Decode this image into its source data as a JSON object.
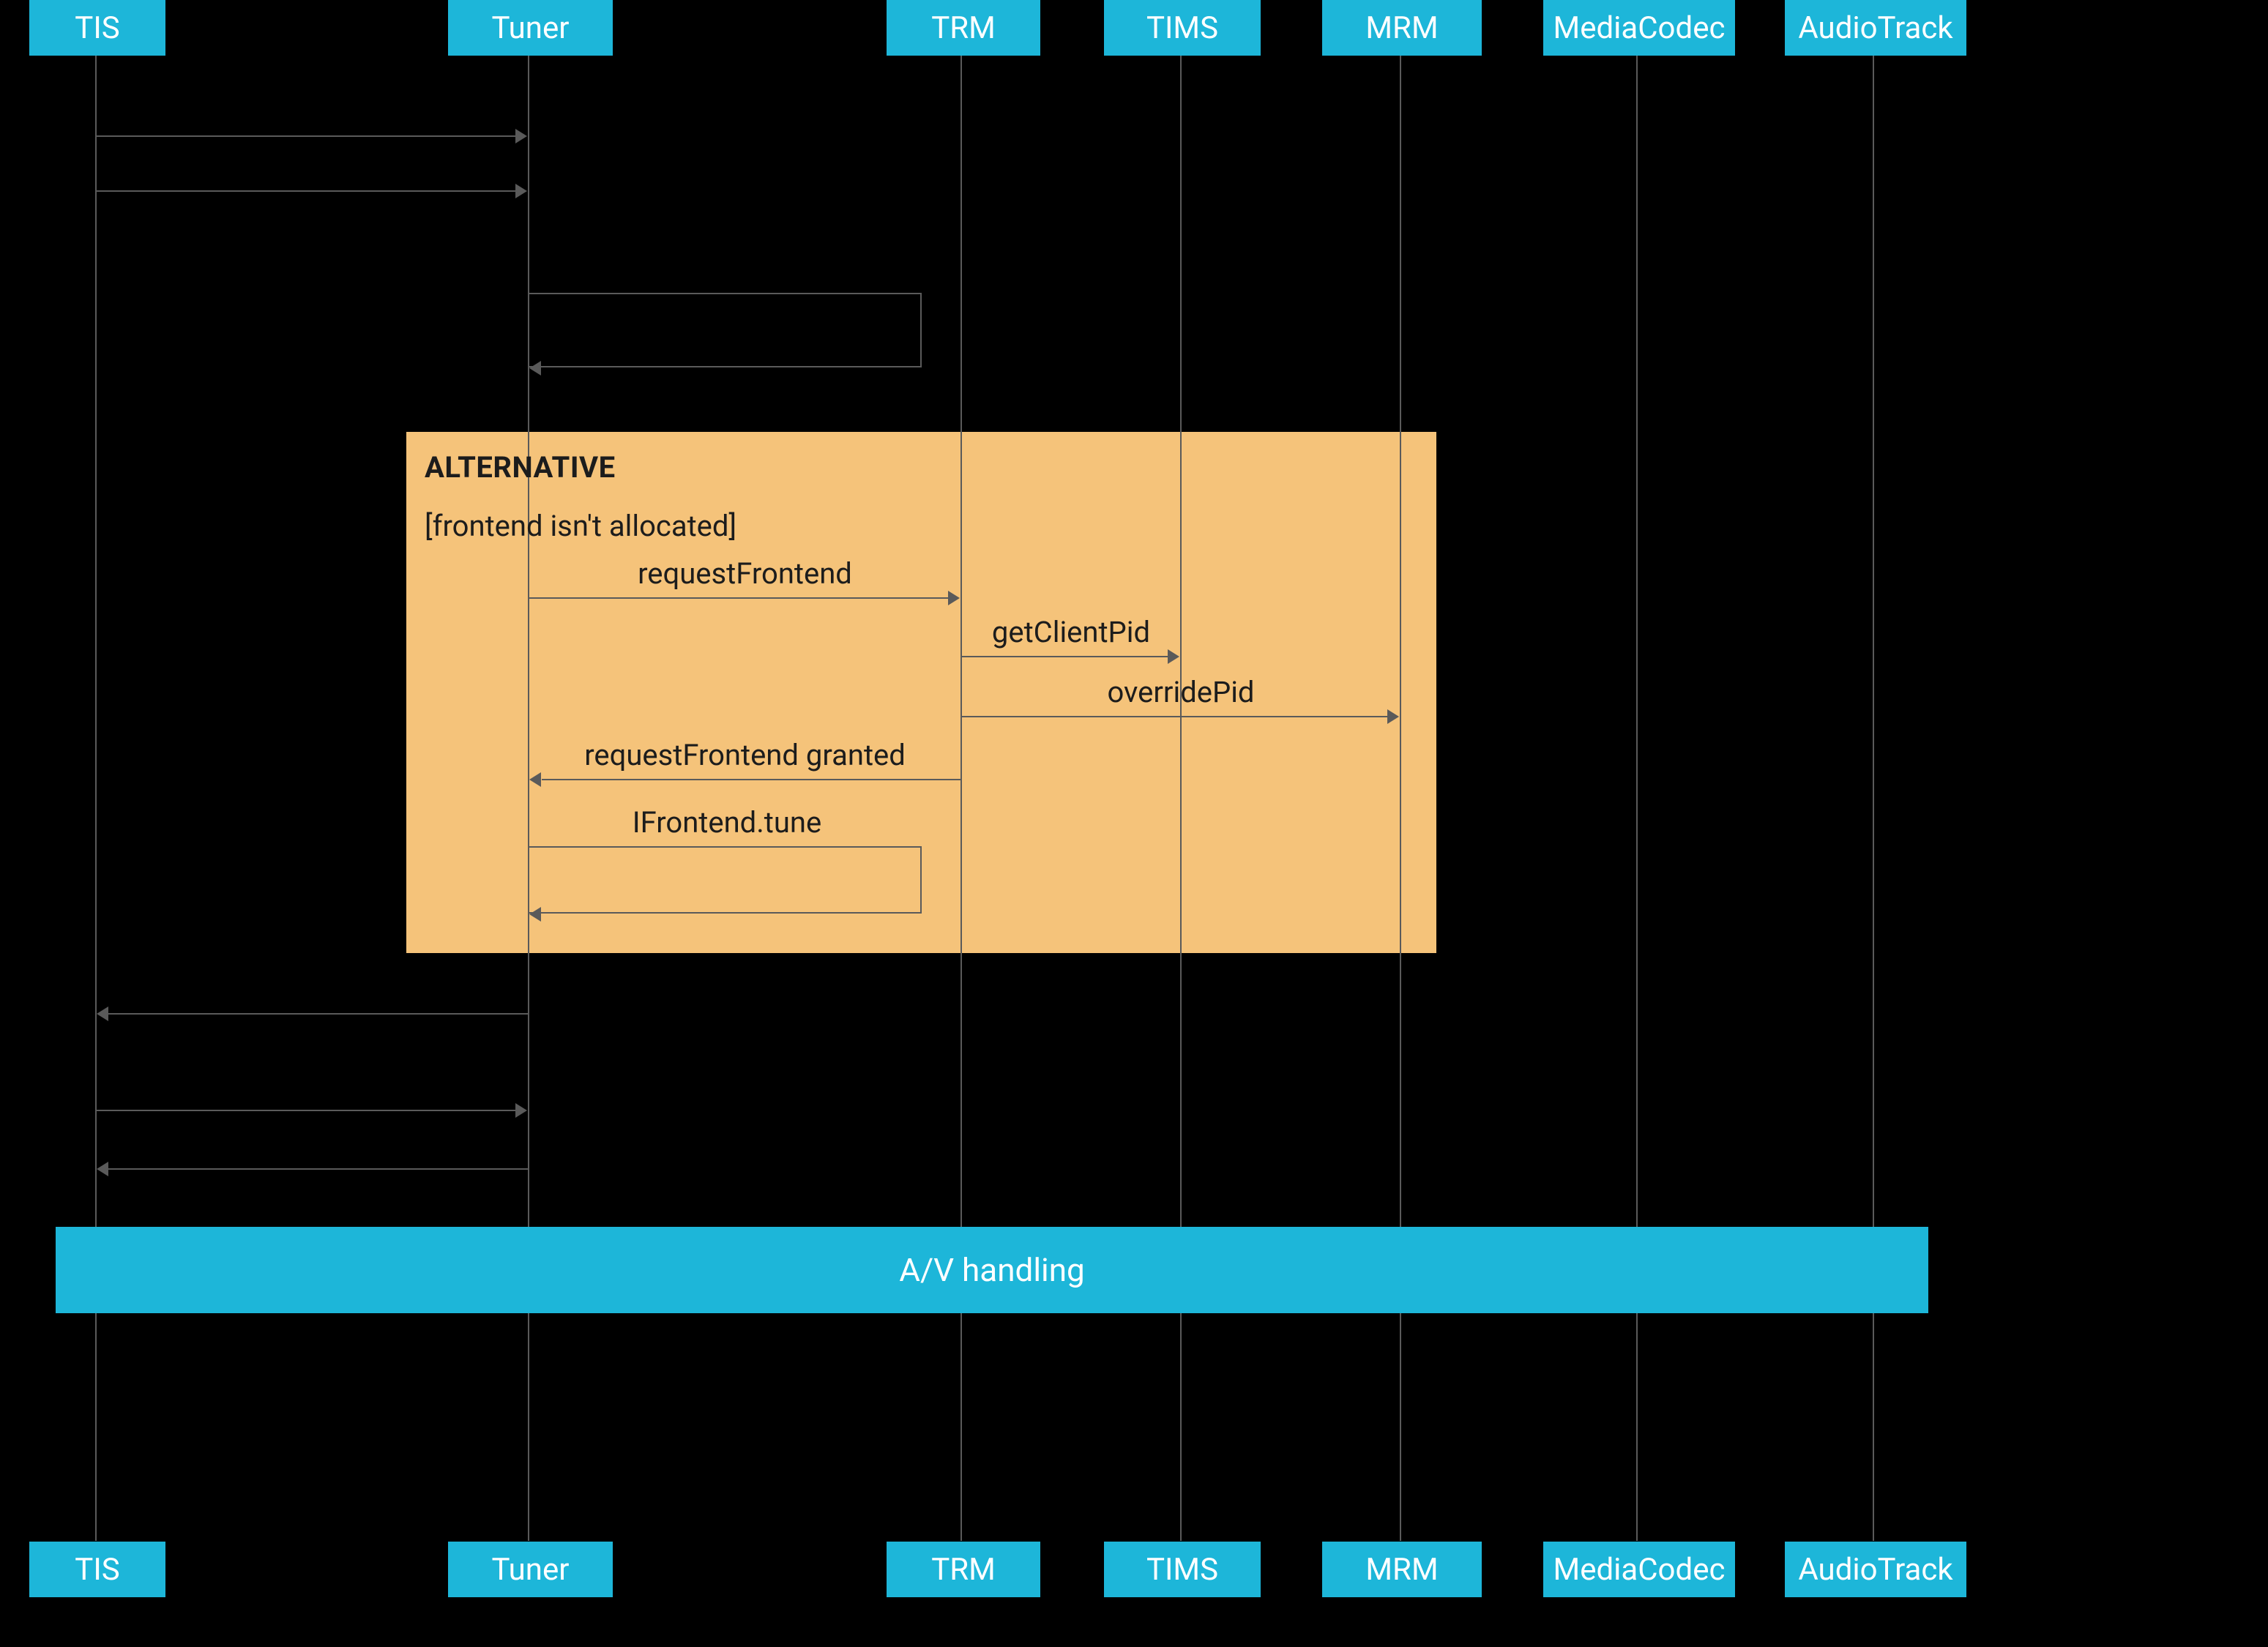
{
  "diagram_type": "sequence",
  "colors": {
    "participant": "#1DB6D9",
    "alt_block": "#F5C37A",
    "line": "#5A5A5A",
    "background": "#000000"
  },
  "participants": [
    {
      "id": "tis",
      "label": "TIS"
    },
    {
      "id": "tuner",
      "label": "Tuner"
    },
    {
      "id": "trm",
      "label": "TRM"
    },
    {
      "id": "tims",
      "label": "TIMS"
    },
    {
      "id": "mrm",
      "label": "MRM"
    },
    {
      "id": "mediacodec",
      "label": "MediaCodec"
    },
    {
      "id": "audiotrack",
      "label": "AudioTrack"
    }
  ],
  "alt_block": {
    "title": "ALTERNATIVE",
    "condition": "[frontend isn't allocated]"
  },
  "messages": {
    "m1": {
      "from": "tis",
      "to": "tuner",
      "label": "",
      "dir": "right"
    },
    "m2": {
      "from": "tis",
      "to": "tuner",
      "label": "",
      "dir": "right"
    },
    "m3_self": {
      "on": "tuner",
      "label": ""
    },
    "m4": {
      "from": "tuner",
      "to": "trm",
      "label": "requestFrontend",
      "dir": "right"
    },
    "m5": {
      "from": "trm",
      "to": "tims",
      "label": "getClientPid",
      "dir": "right"
    },
    "m6": {
      "from": "trm",
      "to": "mrm",
      "label": "overridePid",
      "dir": "right"
    },
    "m7": {
      "from": "trm",
      "to": "tuner",
      "label": "requestFrontend granted",
      "dir": "left"
    },
    "m8_self": {
      "on": "tuner",
      "label": "IFrontend.tune"
    },
    "m9": {
      "from": "tuner",
      "to": "tis",
      "label": "",
      "dir": "left"
    },
    "m10": {
      "from": "tis",
      "to": "tuner",
      "label": "",
      "dir": "right"
    },
    "m11": {
      "from": "tuner",
      "to": "tis",
      "label": "",
      "dir": "left"
    }
  },
  "banner": {
    "label": "A/V handling"
  }
}
